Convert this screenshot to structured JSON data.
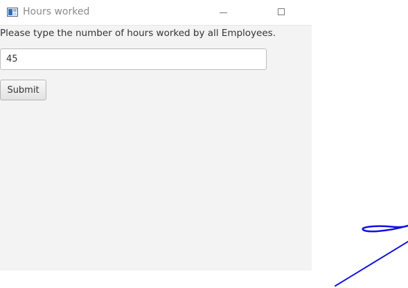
{
  "window": {
    "title": "Hours worked",
    "controls": {
      "minimize_icon": "minimize-icon",
      "maximize_icon": "maximize-icon"
    }
  },
  "form": {
    "prompt": "Please type the number of hours worked by all Employees.",
    "hours_input_value": "45",
    "submit_label": "Submit"
  },
  "colors": {
    "window_background": "#f3f3f3",
    "titlebar_background": "#ffffff",
    "title_text": "#8a8a8a",
    "ink_stroke": "#1010e0"
  }
}
